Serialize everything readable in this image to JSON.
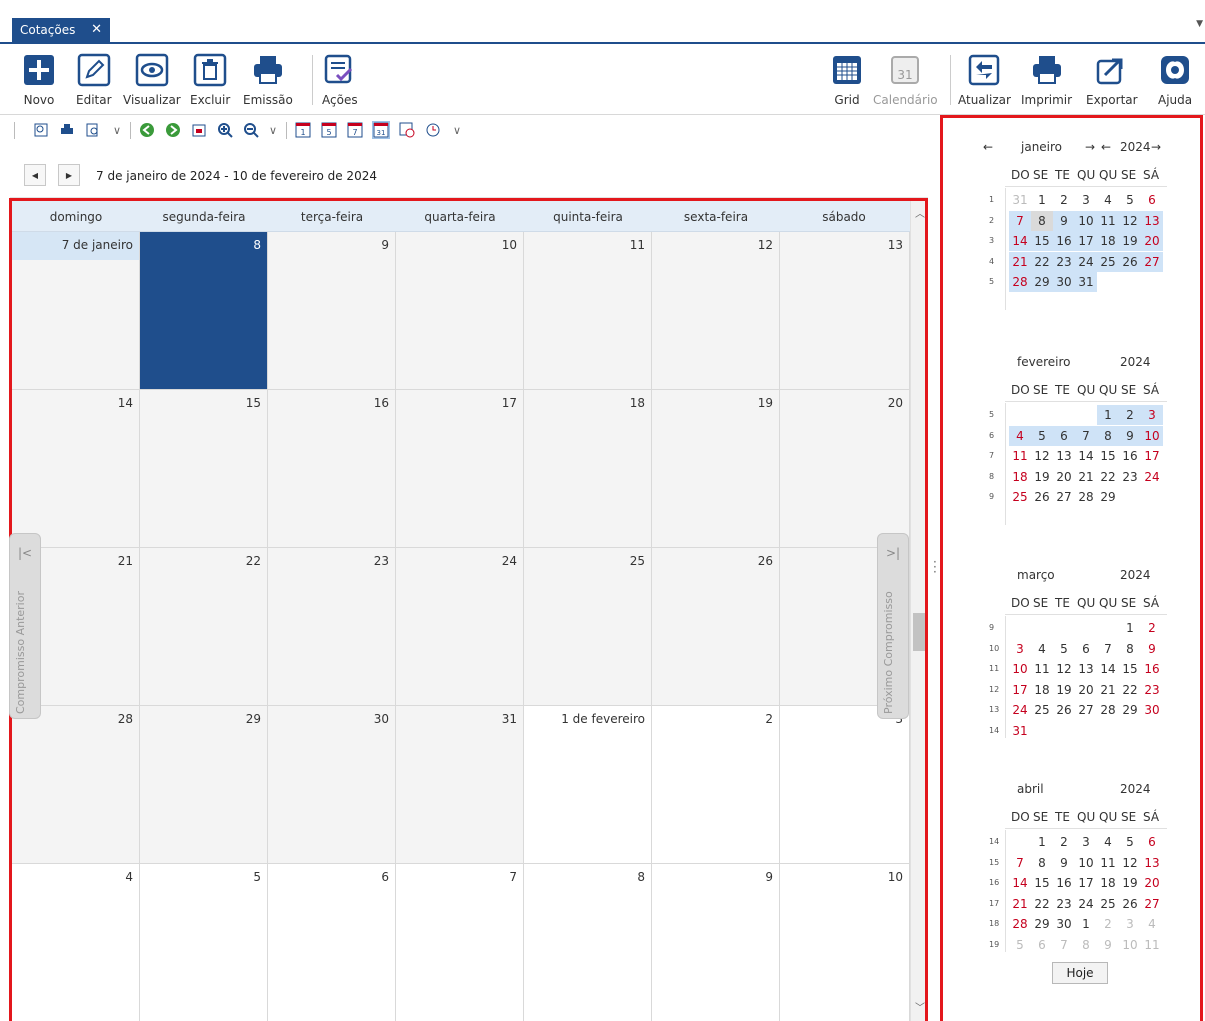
{
  "tab": {
    "label": "Cotações",
    "close": "✕"
  },
  "ribbon": {
    "buttons": [
      {
        "label": "Novo"
      },
      {
        "label": "Editar"
      },
      {
        "label": "Visualizar"
      },
      {
        "label": "Excluir"
      },
      {
        "label": "Emissão"
      },
      {
        "label": "Ações"
      },
      {
        "label": "Grid"
      },
      {
        "label": "Calendário"
      },
      {
        "label": "Atualizar"
      },
      {
        "label": "Imprimir"
      },
      {
        "label": "Exportar"
      },
      {
        "label": "Ajuda"
      }
    ]
  },
  "nav": {
    "range": "7 de janeiro de 2024 - 10 de fevereiro de 2024"
  },
  "weekdays": [
    "domingo",
    "segunda-feira",
    "terça-feira",
    "quarta-feira",
    "quinta-feira",
    "sexta-feira",
    "sábado"
  ],
  "weeks": [
    [
      "7 de janeiro",
      "8",
      "9",
      "10",
      "11",
      "12",
      "13"
    ],
    [
      "14",
      "15",
      "16",
      "17",
      "18",
      "19",
      "20"
    ],
    [
      "21",
      "22",
      "23",
      "24",
      "25",
      "26",
      "27"
    ],
    [
      "28",
      "29",
      "30",
      "31",
      "1 de fevereiro",
      "2",
      "3"
    ],
    [
      "4",
      "5",
      "6",
      "7",
      "8",
      "9",
      "10"
    ]
  ],
  "side_prev": "Compromisso Anterior",
  "side_next": "Próximo Compromisso",
  "mini_dow": [
    "DO",
    "SE",
    "TE",
    "QU",
    "QU",
    "SE",
    "SÁ"
  ],
  "months": [
    {
      "name": "janeiro",
      "year": "2024",
      "prev": "←",
      "next": "→",
      "weeks": [
        [
          "1",
          "31",
          "1",
          "2",
          "3",
          "4",
          "5",
          "6"
        ],
        [
          "2",
          "7",
          "8",
          "9",
          "10",
          "11",
          "12",
          "13"
        ],
        [
          "3",
          "14",
          "15",
          "16",
          "17",
          "18",
          "19",
          "20"
        ],
        [
          "4",
          "21",
          "22",
          "23",
          "24",
          "25",
          "26",
          "27"
        ],
        [
          "5",
          "28",
          "29",
          "30",
          "31",
          "",
          "",
          ""
        ]
      ]
    },
    {
      "name": "fevereiro",
      "year": "2024",
      "weeks": [
        [
          "5",
          "",
          "",
          "",
          "",
          "1",
          "2",
          "3"
        ],
        [
          "6",
          "4",
          "5",
          "6",
          "7",
          "8",
          "9",
          "10"
        ],
        [
          "7",
          "11",
          "12",
          "13",
          "14",
          "15",
          "16",
          "17"
        ],
        [
          "8",
          "18",
          "19",
          "20",
          "21",
          "22",
          "23",
          "24"
        ],
        [
          "9",
          "25",
          "26",
          "27",
          "28",
          "29",
          "",
          ""
        ]
      ]
    },
    {
      "name": "março",
      "year": "2024",
      "weeks": [
        [
          "9",
          "",
          "",
          "",
          "",
          "",
          "1",
          "2"
        ],
        [
          "10",
          "3",
          "4",
          "5",
          "6",
          "7",
          "8",
          "9"
        ],
        [
          "11",
          "10",
          "11",
          "12",
          "13",
          "14",
          "15",
          "16"
        ],
        [
          "12",
          "17",
          "18",
          "19",
          "20",
          "21",
          "22",
          "23"
        ],
        [
          "13",
          "24",
          "25",
          "26",
          "27",
          "28",
          "29",
          "30"
        ],
        [
          "14",
          "31",
          "",
          "",
          "",
          "",
          "",
          ""
        ]
      ]
    },
    {
      "name": "abril",
      "year": "2024",
      "weeks": [
        [
          "14",
          "",
          "1",
          "2",
          "3",
          "4",
          "5",
          "6"
        ],
        [
          "15",
          "7",
          "8",
          "9",
          "10",
          "11",
          "12",
          "13"
        ],
        [
          "16",
          "14",
          "15",
          "16",
          "17",
          "18",
          "19",
          "20"
        ],
        [
          "17",
          "21",
          "22",
          "23",
          "24",
          "25",
          "26",
          "27"
        ],
        [
          "18",
          "28",
          "29",
          "30",
          "1",
          "2",
          "3",
          "4"
        ],
        [
          "19",
          "5",
          "6",
          "7",
          "8",
          "9",
          "10",
          "11"
        ]
      ]
    }
  ],
  "today_button": "Hoje",
  "colors": {
    "accent": "#1f4e8c",
    "highlight": "#e3171c",
    "weekend": "#c5001e"
  }
}
